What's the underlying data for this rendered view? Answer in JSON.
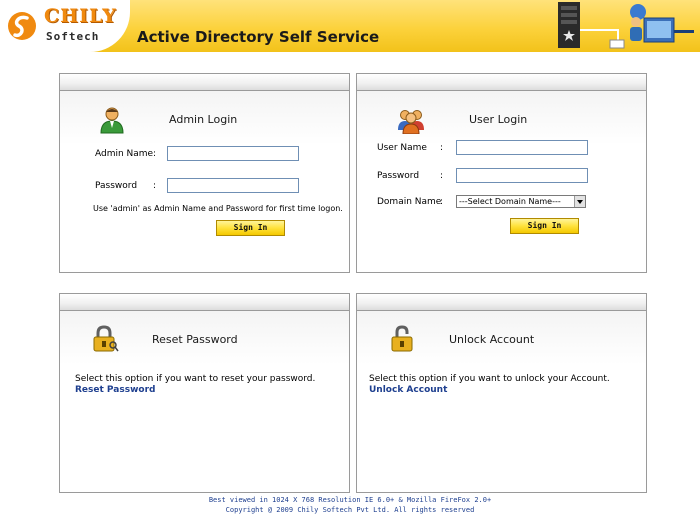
{
  "header": {
    "logo_name": "CHILY",
    "logo_sub": "Softech",
    "title": "Active Directory Self Service",
    "icons": [
      "chily-logo-icon",
      "server-network-icon"
    ]
  },
  "admin_login": {
    "title": "Admin Login",
    "icon": "admin-user-icon",
    "name_label": "Admin Name",
    "password_label": "Password",
    "colon": ":",
    "name_value": "",
    "password_value": "",
    "hint": "Use 'admin' as Admin Name and Password for first time logon.",
    "signin_label": "Sign In"
  },
  "user_login": {
    "title": "User Login",
    "icon": "users-group-icon",
    "name_label": "User Name",
    "password_label": "Password",
    "domain_label": "Domain Name",
    "colon": ":",
    "name_value": "",
    "password_value": "",
    "domain_selected": "---Select Domain Name---",
    "signin_label": "Sign In"
  },
  "reset_password": {
    "title": "Reset Password",
    "icon": "padlock-key-icon",
    "description": "Select this option if you want to reset your password.",
    "link": "Reset Password"
  },
  "unlock_account": {
    "title": "Unlock Account",
    "icon": "open-padlock-icon",
    "description": "Select this option if you want to unlock your Account.",
    "link": "Unlock Account"
  },
  "footer": {
    "line1": "Best viewed in 1024 X 768 Resolution IE 6.0+ & Mozilla FireFox 2.0+",
    "line2": "Copyright @ 2009 Chily Softech Pvt Ltd. All rights reserved"
  },
  "colors": {
    "header_yellow": "#fcd23c",
    "logo_orange": "#f08a10",
    "link_blue": "#1e3f8f",
    "button_yellow": "#ffe23c"
  }
}
